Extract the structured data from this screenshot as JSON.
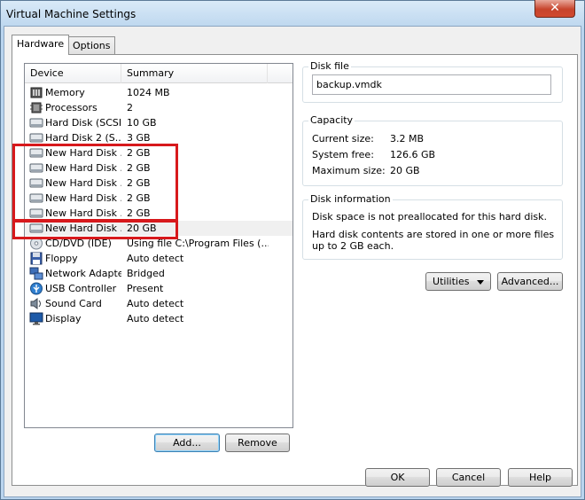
{
  "window": {
    "title": "Virtual Machine Settings",
    "close_glyph": "✕"
  },
  "tabs": [
    {
      "label": "Hardware",
      "active": true
    },
    {
      "label": "Options",
      "active": false
    }
  ],
  "device_list": {
    "columns": {
      "device": "Device",
      "summary": "Summary"
    },
    "rows": [
      {
        "icon": "memory-icon",
        "device": "Memory",
        "summary": "1024 MB"
      },
      {
        "icon": "processor-icon",
        "device": "Processors",
        "summary": "2"
      },
      {
        "icon": "hard-disk-icon",
        "device": "Hard Disk (SCSI)",
        "summary": "10 GB"
      },
      {
        "icon": "hard-disk-icon",
        "device": "Hard Disk 2 (S...",
        "summary": "3 GB"
      },
      {
        "icon": "hard-disk-icon",
        "device": "New Hard Disk ...",
        "summary": "2 GB"
      },
      {
        "icon": "hard-disk-icon",
        "device": "New Hard Disk ...",
        "summary": "2 GB"
      },
      {
        "icon": "hard-disk-icon",
        "device": "New Hard Disk ...",
        "summary": "2 GB"
      },
      {
        "icon": "hard-disk-icon",
        "device": "New Hard Disk ...",
        "summary": "2 GB"
      },
      {
        "icon": "hard-disk-icon",
        "device": "New Hard Disk ...",
        "summary": "2 GB"
      },
      {
        "icon": "hard-disk-icon",
        "device": "New Hard Disk ...",
        "summary": "20 GB",
        "selected": true
      },
      {
        "icon": "cd-dvd-icon",
        "device": "CD/DVD (IDE)",
        "summary": "Using file C:\\Program Files (..."
      },
      {
        "icon": "floppy-icon",
        "device": "Floppy",
        "summary": "Auto detect"
      },
      {
        "icon": "network-adapter-icon",
        "device": "Network Adapter",
        "summary": "Bridged"
      },
      {
        "icon": "usb-icon",
        "device": "USB Controller",
        "summary": "Present"
      },
      {
        "icon": "sound-card-icon",
        "device": "Sound Card",
        "summary": "Auto detect"
      },
      {
        "icon": "display-icon",
        "device": "Display",
        "summary": "Auto detect"
      }
    ]
  },
  "list_buttons": {
    "add": "Add...",
    "remove": "Remove"
  },
  "disk_file": {
    "title": "Disk file",
    "value": "backup.vmdk"
  },
  "capacity": {
    "title": "Capacity",
    "current_size_label": "Current size:",
    "current_size_value": "3.2 MB",
    "system_free_label": "System free:",
    "system_free_value": "126.6 GB",
    "maximum_size_label": "Maximum size:",
    "maximum_size_value": "20 GB"
  },
  "disk_information": {
    "title": "Disk information",
    "line1": "Disk space is not preallocated for this hard disk.",
    "line2": "Hard disk contents are stored in one or more files up to 2 GB each."
  },
  "panel_buttons": {
    "utilities": "Utilities",
    "advanced": "Advanced..."
  },
  "dialog_buttons": {
    "ok": "OK",
    "cancel": "Cancel",
    "help": "Help"
  },
  "colors": {
    "highlight": "#d7191c",
    "selected_row": "#f0f0f0"
  }
}
